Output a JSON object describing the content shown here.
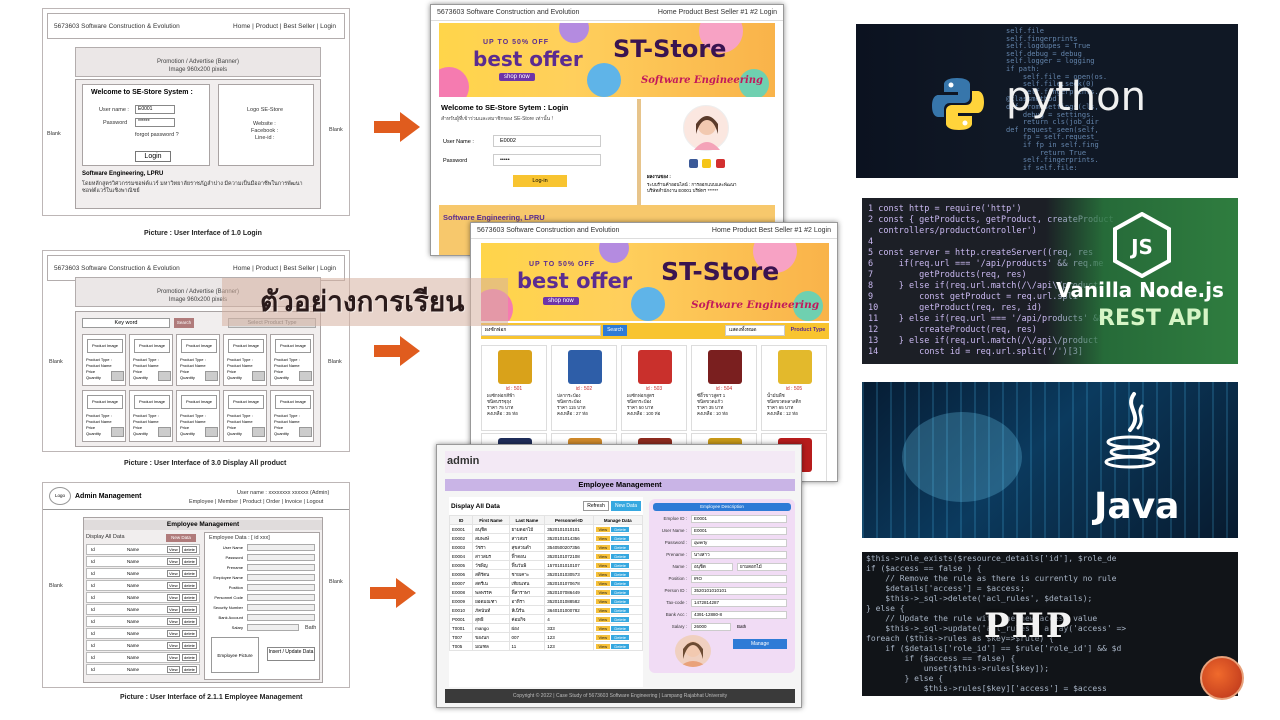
{
  "overlay_text": "ตัวอย่างการเรียน",
  "wireframe_login": {
    "header_left": "5673603 Software Construction & Evolution",
    "header_right": "Home | Product | Best Seller | Login",
    "banner_line1": "Promotion / Advertise (Banner)",
    "banner_line2": "Image 960x200 pixels",
    "welcome": "Welcome to SE-Store System :",
    "user_label": "User name :",
    "user_value": "E0001",
    "password_label": "Password",
    "password_value": "******",
    "forgot": "forgot password ?",
    "login_button": "Login",
    "logo_text": "Logo SE-Store",
    "website": "Website :",
    "facebook": "Facebook :",
    "line_id": "Line-id :",
    "blank_left": "Blank",
    "blank_right": "Blank",
    "footer_title": "Software Engineering, LPRU",
    "footer_desc": "โดยหลักสูตรวิศวกรรมซอฟต์แวร์ มหาวิทยาลัยราชภัฏลำปาง มีความเป็นมืออาชีพในการพัฒนาซอฟต์แวร์ในเชิงพาณิชย์",
    "caption": "Picture : User Interface of  1.0 Login"
  },
  "wireframe_products": {
    "header_left": "5673603 Software Construction & Evolution",
    "header_right": "Home | Product | Best Seller | Login",
    "banner_line1": "Promotion / Advertise (Banner)",
    "banner_line2": "Image 960x200 pixels",
    "keyword": "Key word",
    "search_button": "Search",
    "select_type": "Select Product Type",
    "product_image": "Product Image",
    "product_type": "Product Type :",
    "product_name": "Product Name",
    "price": "Price",
    "quantity": "Quantity",
    "blank_left": "Blank",
    "blank_right": "Blank",
    "caption": "Picture : User Interface of  3.0 Display All product"
  },
  "wireframe_employee": {
    "logo": "Logo",
    "title": "Admin Management",
    "user_name": "User name : xxxxxxxx xxxxxx (Admin)",
    "menu": "Employee | Member | Product | Order | Invoice | Logout",
    "section_title": "Employee Management",
    "display_all": "Display All Data",
    "new_data": "New Data",
    "employee_data": "Employee Data : [ id xxx]",
    "row_id": "Id",
    "row_name": "Name",
    "view": "View",
    "delete": "delete",
    "fields": [
      "User Name",
      "Password",
      "Prename",
      "Employee Name",
      "Position",
      "Personnel Code",
      "Security Number",
      "Bank Account",
      "Salary"
    ],
    "bath": "Bath",
    "employee_picture": "Employee Picture",
    "insert_update": "Insert / Update Data",
    "blank_left": "Blank",
    "blank_right": "Blank",
    "caption": "Picture : User Interface of  2.1.1 Employee Management"
  },
  "shot_login": {
    "header_left": "5673603 Software Construction and Evolution",
    "header_right": "Home  Product  Best Seller #1  #2  Login",
    "banner_small": "UP TO 50% OFF",
    "banner_big": "best offer",
    "banner_shop": "shop now",
    "store_title": "ST-Store",
    "store_sub": "Software Engineering",
    "welcome": "Welcome to SE-Store Sytem : Login",
    "welcome_desc": "สำหรับผู้ที่เข้าร่วมและสมาชิกของ SE-Store เท่านั้น !",
    "user_label": "User Name :",
    "user_value": "E0002",
    "password_label": "Password",
    "password_value": "•••••",
    "login_button": "Log-in",
    "footer_title": "Software Engineering, LPRU",
    "contact_title": "ผลงานของ :",
    "contact_line": "ระบบร้านค้าออนไลน์ : การออกแบบและพัฒนา",
    "contact_line2": "บริษัทสำนักงาน E0001 บริษัทฯ ******"
  },
  "shot_products": {
    "header_left": "5673603 Software Construction and Evolution",
    "header_right": "Home  Product  Best Seller #1  #2  Login",
    "banner_small": "UP TO 50% OFF",
    "banner_big": "best offer",
    "banner_shop": "shop now",
    "store_title": "ST-Store",
    "store_sub": "Software Engineering",
    "search_value": "ผงซักฟอก",
    "search_button": "Search",
    "select_value": "แสดงทั้งหมด",
    "product_type_btn": "Product Type",
    "products": [
      {
        "id": "id : 501",
        "line1": "ผงซักฟอกสีฟ้า",
        "line2": "ชนิดบรรจุถุง",
        "line3": "ราคา 75 บาท",
        "line4": "คงเหลือ : 35 ห่อ",
        "color": "#d9a21a"
      },
      {
        "id": "id : 502",
        "line1": "ปลากระป๋อง",
        "line2": "ชนิดกระป๋อง",
        "line3": "ราคา 115 บาท",
        "line4": "คงเหลือ : 27 ห่อ",
        "color": "#2e5ea8"
      },
      {
        "id": "id : 503",
        "line1": "ผงซักฟอกสูตร",
        "line2": "ชนิดกระป๋อง",
        "line3": "ราคา 50 บาท",
        "line4": "คงเหลือ : 100 ห่อ",
        "color": "#c9302c"
      },
      {
        "id": "id : 504",
        "line1": "ซีอิ๊วขาวสูตร 1",
        "line2": "ชนิดขวดแก้ว",
        "line3": "ราคา 35 บาท",
        "line4": "คงเหลือ : 10 ห่อ",
        "color": "#7a1f1f"
      },
      {
        "id": "id : 505",
        "line1": "น้ำมันพืช",
        "line2": "ชนิดขวดพลาสติก",
        "line3": "ราคา 65 บาท",
        "line4": "คงเหลือ : 12 ห่อ",
        "color": "#e3b92c"
      },
      {
        "id": "id : 506",
        "line1": "",
        "line2": "",
        "line3": "",
        "line4": "",
        "color": "#1f2d5a"
      },
      {
        "id": "id : 507",
        "line1": "",
        "line2": "",
        "line3": "",
        "line4": "",
        "color": "#d08a2a"
      },
      {
        "id": "id : 508",
        "line1": "",
        "line2": "",
        "line3": "",
        "line4": "",
        "color": "#8e2b1e"
      },
      {
        "id": "id : 509",
        "line1": "",
        "line2": "",
        "line3": "",
        "line4": "",
        "color": "#c99a18"
      },
      {
        "id": "id : 510",
        "line1": "",
        "line2": "",
        "line3": "",
        "line4": "",
        "color": "#b71c1c"
      }
    ]
  },
  "shot_employee": {
    "header_title": "admin",
    "section_title": "Employee Management",
    "display_all": "Display All Data",
    "refresh": "Refresh",
    "new_data": "New Data",
    "columns": [
      "ID",
      "First Name",
      "Last Name",
      "Personnel-ID",
      "Manage Data"
    ],
    "rows": [
      [
        "E0001",
        "อนุชิต",
        "ยามดอกไม้",
        "3520101010101",
        "View",
        "Delete"
      ],
      [
        "E0002",
        "สมพงษ์",
        "สาวสมร",
        "3520101014356",
        "View",
        "Delete"
      ],
      [
        "E0003",
        "วัชรา",
        "สุขสวนดำ",
        "3540500207356",
        "View",
        "Delete"
      ],
      [
        "E0004",
        "สาวสมร",
        "ฟิ้าดอน",
        "3520101072108",
        "View",
        "Delete"
      ],
      [
        "E0005",
        "วัชพิญ",
        "ฟิ้นวันพิ",
        "1570101010107",
        "View",
        "Delete"
      ],
      [
        "E0006",
        "สติรัตน",
        "ชายเคาะ",
        "3520101030573",
        "View",
        "Delete"
      ],
      [
        "E0007",
        "สตรีเน",
        "เทียนเทน",
        "3520101070678",
        "View",
        "Delete"
      ],
      [
        "E0008",
        "พลพรรค",
        "ฟิ้สาราษา",
        "3520107086449",
        "View",
        "Delete"
      ],
      [
        "E0009",
        "ยอดมณฑา",
        "อาหิรา",
        "3520101088582",
        "View",
        "Delete"
      ],
      [
        "E0010",
        "ภัคนันท์",
        "ลีเนิร์น",
        "3640101000782",
        "View",
        "Delete"
      ],
      [
        "P0001",
        "สุทธิ",
        "ค่อมกิจ",
        "4",
        "View",
        "Delete"
      ],
      [
        "T0001",
        "mango",
        "ผ่อง",
        "333",
        "View",
        "Delete"
      ],
      [
        "T007",
        "ของนก",
        "007",
        "123",
        "View",
        "Delete"
      ],
      [
        "T005",
        "มณฑล",
        "11",
        "123",
        "View",
        "Delete"
      ]
    ],
    "detail_title": "Employee Description",
    "detail_fields": [
      {
        "label": "Emploe ID :",
        "value": "E0001"
      },
      {
        "label": "User Name :",
        "value": "E0001"
      },
      {
        "label": "Password :",
        "value": "qwerty"
      },
      {
        "label": "Prename :",
        "value": "นางสาว"
      },
      {
        "label": "Name :",
        "value": "อนุชิต"
      },
      {
        "label": "Position :",
        "value": "IRO"
      },
      {
        "label": "Person ID :",
        "value": "3520101010101"
      },
      {
        "label": "Tax-code :",
        "value": "1472814287"
      },
      {
        "label": "Bank Acc :",
        "value": "4391-12880-8"
      },
      {
        "label": "Salary :",
        "value": "26000"
      }
    ],
    "lastname_value": "ยามดอกไม้",
    "bath": "Bath",
    "manage_button": "Manage",
    "footer": "Copyright © 2022 | Case Study of 5673603 Software Engineering | Lampang Rajabhat University"
  },
  "tech": {
    "python_label": "python",
    "node_label_1": "Vanilla Node.js",
    "node_label_2": "REST API",
    "java_label": "Java",
    "php_label": "PHP",
    "node_code": [
      "1 const http = require('http')",
      "2 const { getProducts, getProduct, createProduct",
      "  controllers/productController')",
      "4",
      "5 const server = http.createServer((req, res",
      "6     if(req.url === '/api/products' && req.me",
      "7         getProducts(req, res)",
      "8     } else if(req.url.match(/\\/api\\/products",
      "9         const getProduct = req.url.spli",
      "10        getProduct(req, res, id)",
      "11    } else if(req.url === '/api/products' &&",
      "12        createProduct(req, res)",
      "13    } else if(req.url.match(/\\/api\\/product",
      "14        const id = req.url.split('/')[3]"
    ],
    "python_code": [
      "self.file",
      "self.fingerprints",
      "self.logdupes = True",
      "self.debug = debug",
      "self.logger = logging",
      "if path:",
      "    self.file = open(os.",
      "    self.file.seek(0)",
      "    self.fingerprints.",
      "@classmethod",
      "def from_settings(cls,",
      "    debug = settings.",
      "    return cls(job_dir",
      "def request_seen(self,",
      "    fp = self.request_",
      "    if fp in self.fing",
      "        return True",
      "    self.fingerprints.",
      "    if self.file:"
    ],
    "php_code": [
      "$this->rule_exists($resource_details['id'], $role_de",
      "if ($access == false ) {",
      "    // Remove the rule as there is currently no rule",
      "    $details['access'] = $access;",
      "    $this->_sql->delete('acl_rules', $details);",
      "} else {",
      "    // Update the rule with the new access value",
      "    $this->_sql->update('acl_rules', array('access' =>",
      "foreach ($this->rules as $key=>$rule) {",
      "    if ($details['role_id'] == $rule['role_id'] && $d",
      "        if ($access == false) {",
      "            unset($this->rules[$key]);",
      "        } else {",
      "            $this->rules[$key]['access'] = $access"
    ]
  }
}
